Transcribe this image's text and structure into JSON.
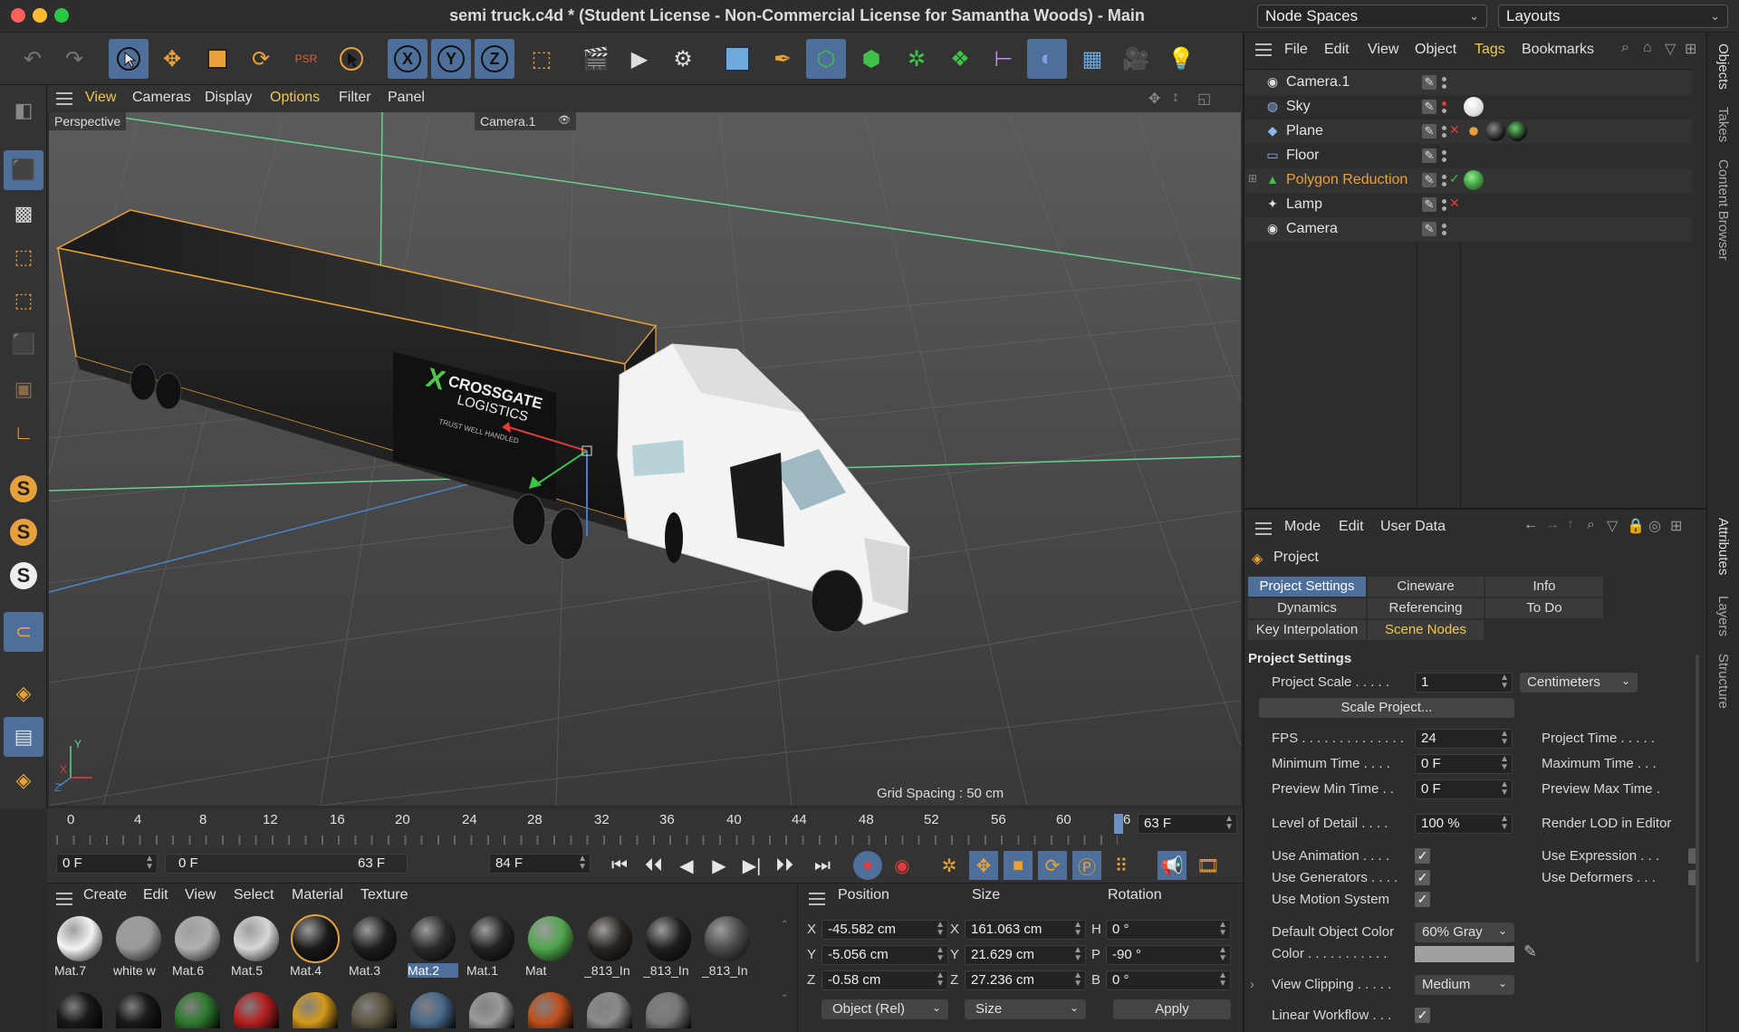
{
  "window": {
    "title": "semi truck.c4d * (Student License - Non-Commercial License for Samantha Woods) - Main",
    "node_spaces": "Node Spaces",
    "layouts": "Layouts"
  },
  "viewport": {
    "menu": [
      "View",
      "Cameras",
      "Display",
      "Options",
      "Filter",
      "Panel"
    ],
    "view_name": "Perspective",
    "camera_label": "Camera.1",
    "grid_spacing": "Grid Spacing : 50 cm",
    "axis_labels": {
      "x": "X",
      "y": "Y",
      "z": "Z"
    },
    "truck_logo": {
      "line1": "CROSSGATE",
      "line2": "LOGISTICS",
      "tagline": "TRUST WELL HANDLED",
      "mark": "X"
    }
  },
  "timeline": {
    "ticks": [
      "0",
      "4",
      "8",
      "12",
      "16",
      "20",
      "24",
      "28",
      "32",
      "36",
      "40",
      "44",
      "48",
      "52",
      "56",
      "60",
      "6"
    ],
    "current_frame": "63 F",
    "start": "0 F",
    "range_start": "0 F",
    "range_end": "63 F",
    "end": "84 F"
  },
  "materials": {
    "menu": [
      "Create",
      "Edit",
      "View",
      "Select",
      "Material",
      "Texture"
    ],
    "items": [
      {
        "label": "Mat.7",
        "color": "#f4f4f4"
      },
      {
        "label": "white w",
        "color": "#9a9a9a"
      },
      {
        "label": "Mat.6",
        "color": "#b0b0b0"
      },
      {
        "label": "Mat.5",
        "color": "#d6d6d6"
      },
      {
        "label": "Mat.4",
        "color": "#1a1a1a"
      },
      {
        "label": "Mat.3",
        "color": "#1e1e1e"
      },
      {
        "label": "Mat.2",
        "color": "#2a2a2a"
      },
      {
        "label": "Mat.1",
        "color": "#222222"
      },
      {
        "label": "Mat",
        "color": "#4fa54b"
      },
      {
        "label": "_813_In",
        "color": "#2a2420"
      },
      {
        "label": "_813_In",
        "color": "#1f1f1f"
      },
      {
        "label": "_813_In",
        "color": "#4a4a4a"
      }
    ],
    "row2_colors": [
      "#1a1a1a",
      "#1a1a1a",
      "#2f7a2f",
      "#b52020",
      "#d49a1c",
      "#5c5540",
      "#4a6a8a",
      "#9a9a9a",
      "#c0501e",
      "#8a8a8a",
      "#777777"
    ]
  },
  "coords": {
    "headers": [
      "Position",
      "Size",
      "Rotation"
    ],
    "rows": [
      {
        "axis": "X",
        "pos": "-45.582 cm",
        "size_axis": "X",
        "size": "161.063 cm",
        "rot_axis": "H",
        "rot": "0 °"
      },
      {
        "axis": "Y",
        "pos": "-5.056 cm",
        "size_axis": "Y",
        "size": "21.629 cm",
        "rot_axis": "P",
        "rot": "-90 °"
      },
      {
        "axis": "Z",
        "pos": "-0.58 cm",
        "size_axis": "Z",
        "size": "27.236 cm",
        "rot_axis": "B",
        "rot": "0 °"
      }
    ],
    "mode": "Object (Rel)",
    "size_mode": "Size",
    "apply": "Apply"
  },
  "objects": {
    "menu": [
      "File",
      "Edit",
      "View",
      "Object",
      "Tags",
      "Bookmarks"
    ],
    "items": [
      {
        "name": "Camera.1",
        "icon": "camera-icon"
      },
      {
        "name": "Sky",
        "icon": "sky-icon"
      },
      {
        "name": "Plane",
        "icon": "plane-icon"
      },
      {
        "name": "Floor",
        "icon": "floor-icon"
      },
      {
        "name": "Polygon Reduction",
        "icon": "polygon-reduction-icon"
      },
      {
        "name": "Lamp",
        "icon": "lamp-icon"
      },
      {
        "name": "Camera",
        "icon": "camera-icon"
      }
    ]
  },
  "attributes": {
    "menu": [
      "Mode",
      "Edit",
      "User Data"
    ],
    "object_name": "Project",
    "tabs": [
      "Project Settings",
      "Cineware",
      "Info",
      "Dynamics",
      "Referencing",
      "To Do",
      "Key Interpolation",
      "Scene Nodes"
    ],
    "section": "Project Settings",
    "project_scale_label": "Project Scale . . . . .",
    "project_scale_value": "1",
    "project_scale_unit": "Centimeters",
    "scale_button": "Scale Project...",
    "fps_label": "FPS . . . . . . . . . . . . . .",
    "fps_value": "24",
    "project_time_label": "Project Time . . . . .",
    "min_time_label": "Minimum Time . . . .",
    "min_time_value": "0 F",
    "max_time_label": "Maximum Time . . .",
    "preview_min_label": "Preview Min Time . .",
    "preview_min_value": "0 F",
    "preview_max_label": "Preview Max Time .",
    "lod_label": "Level of Detail . . . .",
    "lod_value": "100 %",
    "render_lod_label": "Render LOD in Editor",
    "use_animation_label": "Use Animation . . . .",
    "use_expression_label": "Use Expression . . .",
    "use_generators_label": "Use Generators . . . .",
    "use_deformers_label": "Use Deformers . . .",
    "use_motion_label": "Use Motion System",
    "default_color_label": "Default Object Color",
    "default_color_value": "60% Gray",
    "color_label": "Color . . . . . . . . . . .",
    "view_clipping_label": "View Clipping . . . . .",
    "view_clipping_value": "Medium",
    "linear_workflow_label": "Linear Workflow . . ."
  },
  "sidebar_tabs": [
    "Objects",
    "Takes",
    "Content Browser",
    "Attributes",
    "Layers",
    "Structure"
  ],
  "colors": {
    "accent_blue": "#4e6f9a",
    "highlight_yellow": "#f0c94a",
    "polygon_reduction_orange": "#e8a13a",
    "close_red": "#ff5f57",
    "minimize_yellow": "#febc2e",
    "maximize_green": "#28c840"
  }
}
